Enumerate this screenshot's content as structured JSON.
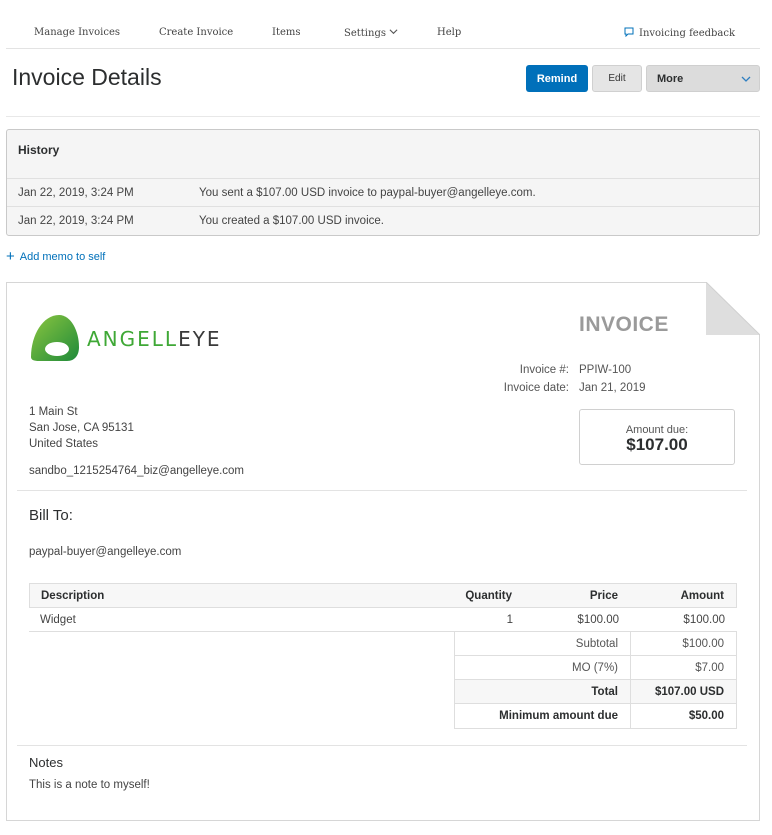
{
  "nav": {
    "items": [
      {
        "label": "Manage Invoices"
      },
      {
        "label": "Create Invoice"
      },
      {
        "label": "Items"
      },
      {
        "label": "Settings"
      },
      {
        "label": "Help"
      }
    ],
    "feedback": "Invoicing feedback"
  },
  "header": {
    "title": "Invoice Details",
    "remind": "Remind",
    "edit": "Edit",
    "more": "More"
  },
  "history": {
    "title": "History",
    "rows": [
      {
        "date": "Jan 22, 2019, 3:24 PM",
        "message": "You sent a $107.00 USD invoice to paypal-buyer@angelleye.com."
      },
      {
        "date": "Jan 22, 2019, 3:24 PM",
        "message": "You created a $107.00 USD invoice."
      }
    ]
  },
  "memo": {
    "label": "Add memo to self"
  },
  "invoice": {
    "logo_text_green": "ANGELL",
    "logo_text_dark": "EYE",
    "heading": "INVOICE",
    "number_label": "Invoice #:",
    "number": "PPIW-100",
    "date_label": "Invoice date:",
    "date": "Jan 21, 2019",
    "amount_due_label": "Amount due:",
    "amount_due": "$107.00",
    "from": {
      "line1": "1 Main St",
      "line2": "San Jose, CA 95131",
      "line3": "United States",
      "email": "sandbo_1215254764_biz@angelleye.com"
    },
    "bill_to_label": "Bill To:",
    "bill_to_email": "paypal-buyer@angelleye.com",
    "columns": {
      "description": "Description",
      "quantity": "Quantity",
      "price": "Price",
      "amount": "Amount"
    },
    "items": [
      {
        "description": "Widget",
        "quantity": "1",
        "price": "$100.00",
        "amount": "$100.00"
      }
    ],
    "totals": [
      {
        "label": "Subtotal",
        "value": "$100.00"
      },
      {
        "label": "MO (7%)",
        "value": "$7.00"
      },
      {
        "label": "Total",
        "value": "$107.00 USD"
      },
      {
        "label": "Minimum amount due",
        "value": "$50.00"
      }
    ],
    "notes_label": "Notes",
    "notes": "This is a note to myself!"
  },
  "colors": {
    "primary": "#0070ba",
    "logo_green": "#3fa836",
    "heading_gray": "#9a9a9a"
  }
}
